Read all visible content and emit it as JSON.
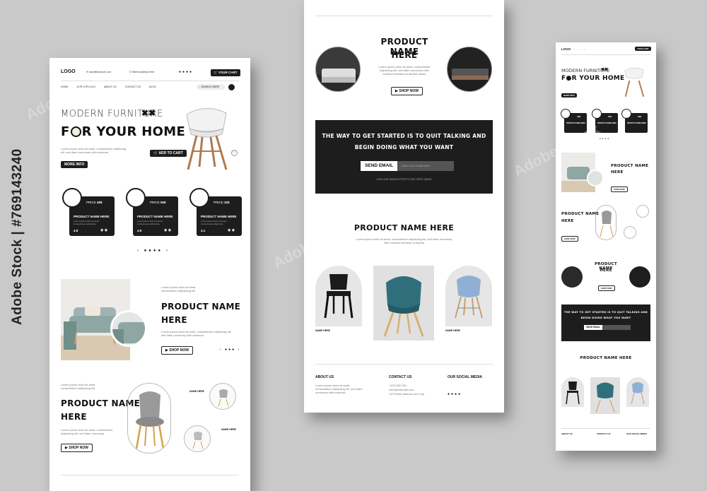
{
  "watermark": {
    "text": "Adobe Stock",
    "id": "#769143240",
    "side": "Adobe Stock | #769143240"
  },
  "left": {
    "logo": "LOGO",
    "email": "user@example.com",
    "address": "Street Address Here",
    "cart": "YOUR CART",
    "nav": [
      "HOME",
      "OUR SERVICES",
      "ABOUT US",
      "CONTACT US",
      "BLOG"
    ],
    "search": "SEARCH HERE",
    "hero": {
      "line1": "MODERN FURNITURE",
      "line2a": "F",
      "line2b": "R YOUR HOME",
      "desc": "Lorem ipsum dolor sit amet, consectetuer adipiscing elit, sed diam nonummy nibh euismod",
      "more": "MORE INFO",
      "add": "ADD TO CART"
    },
    "cards": [
      {
        "price_label": "PRICE",
        "price": "49$",
        "name": "PRODUCT NAME HERE",
        "desc": "Lorem ipsum dolor sit amet consectetuer adipiscing",
        "rating": "4.8"
      },
      {
        "price_label": "PRICE",
        "price": "55$",
        "name": "PRODUCT NAME HERE",
        "desc": "Lorem ipsum dolor sit amet consectetuer adipiscing",
        "rating": "4.9"
      },
      {
        "price_label": "PRICE",
        "price": "32$",
        "name": "PRODUCT NAME HERE",
        "desc": "Lorem ipsum dolor sit amet consectetuer adipiscing",
        "rating": "4.1"
      }
    ],
    "feature1": {
      "title1": "PRODUCT NAME",
      "title2": "HERE",
      "desc": "Lorem ipsum dolor sit amet, consectetuer adipiscing elit, sed diam nonummy nibh euismod",
      "shop": "SHOP NOW"
    },
    "feature2": {
      "title1": "PRODUCT NAME",
      "title2": "HERE",
      "desc": "Lorem ipsum dolor sit amet, consectetuer adipiscing elit, sed diam nonummy",
      "shop": "SHOP NOW",
      "label1": "NAME HERE",
      "label2": "NAME HERE"
    }
  },
  "middle": {
    "p1": {
      "title1": "PRODUCT NAME",
      "title2": "HERE",
      "desc": "Lorem ipsum dolor sit amet, consectetuer adipiscing elit, sed diam nonummy nibh euismod tincidunt ut laoreet dolore",
      "shop": "SHOP NOW"
    },
    "cta": {
      "line1": "THE WAY TO GET STARTED IS TO QUIT TALKING AND",
      "line2": "BEGIN DOING WHAT YOU WANT",
      "button": "SEND EMAIL",
      "placeholder": "Insert Your Email Here",
      "note": "JOIN OUR NEWSLETTER TO GET FIRST NEWS"
    },
    "p2": {
      "title": "PRODUCT NAME HERE",
      "desc": "Lorem ipsum dolor sit amet, consectetuer adipiscing elit, sed diam nonummy nibh euismod tincidunt ut laoreet",
      "label": "NAME HERE"
    },
    "footer": {
      "about_title": "ABOUT US",
      "about_text": "Lorem ipsum dolor sit amet, consectetuer adipiscing elit, sed diam nonummy nibh euismod",
      "contact_title": "CONTACT US",
      "contact_lines": [
        "+123 456 789",
        "user@example.com",
        "123 Street address here city"
      ],
      "social_title": "OUR SOCIAL MEDIA"
    }
  },
  "right": {
    "logo": "LOGO",
    "cart": "YOUR CART",
    "hero": {
      "line1": "MODERN FURNITURE",
      "line2a": "F",
      "line2b": "R YOUR HOME",
      "more": "MORE INFO"
    },
    "cards": [
      {
        "price": "49$",
        "name": "PRODUCT NAME HERE"
      },
      {
        "price": "55$",
        "name": "PRODUCT NAME HERE"
      },
      {
        "price": "32$",
        "name": "PRODUCT NAME HERE"
      }
    ],
    "f1": {
      "title1": "PRODUCT NAME",
      "title2": "HERE",
      "shop": "SHOP NOW"
    },
    "f2": {
      "title1": "PRODUCT NAME",
      "title2": "HERE",
      "shop": "SHOP NOW"
    },
    "f3": {
      "title1": "PRODUCT NAME",
      "title2": "HERE",
      "shop": "SHOP NOW"
    },
    "cta": {
      "line1": "THE WAY TO GET STARTED IS TO QUIT TALKING AND",
      "line2": "BEGIN DOING WHAT YOU WANT",
      "button": "SEND EMAIL"
    },
    "p2": {
      "title": "PRODUCT NAME HERE"
    },
    "footer": {
      "about": "ABOUT US",
      "contact": "CONTACT US",
      "social": "OUR SOCIAL MEDIA"
    }
  },
  "colors": {
    "background": "#c9c9c9",
    "dark": "#1d1d1d",
    "teal": "#2f6f7c",
    "blue": "#8fb0d4",
    "sage": "#8fa7a3"
  }
}
